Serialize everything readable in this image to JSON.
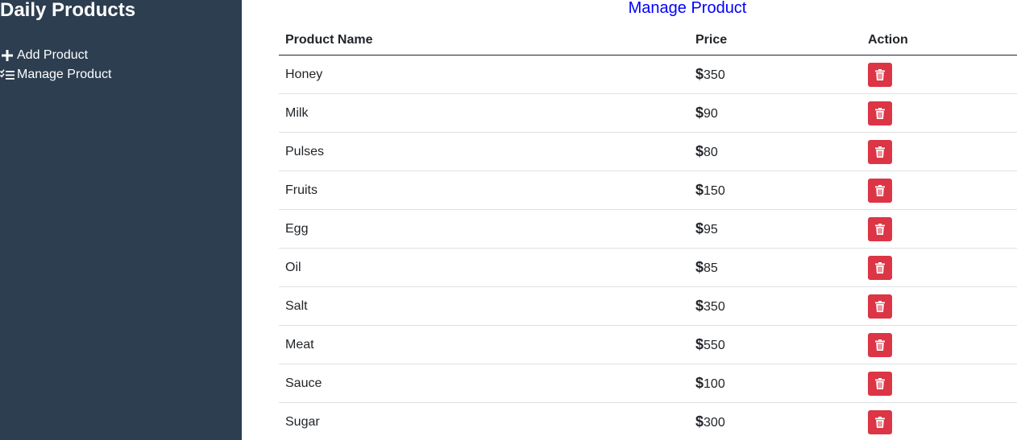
{
  "sidebar": {
    "brand": "Daily Products",
    "nav": [
      {
        "label": "Add Product",
        "icon": "plus-icon"
      },
      {
        "label": "Manage Product",
        "icon": "checklist-icon"
      }
    ]
  },
  "main": {
    "title": "Manage Product",
    "table": {
      "headers": [
        "Product Name",
        "Price",
        "Action"
      ],
      "currency_symbol": "$",
      "rows": [
        {
          "name": "Honey",
          "price": "350"
        },
        {
          "name": "Milk",
          "price": "90"
        },
        {
          "name": "Pulses",
          "price": "80"
        },
        {
          "name": "Fruits",
          "price": "150"
        },
        {
          "name": "Egg",
          "price": "95"
        },
        {
          "name": "Oil",
          "price": "85"
        },
        {
          "name": "Salt",
          "price": "350"
        },
        {
          "name": "Meat",
          "price": "550"
        },
        {
          "name": "Sauce",
          "price": "100"
        },
        {
          "name": "Sugar",
          "price": "300"
        }
      ]
    }
  },
  "colors": {
    "sidebar_bg": "#2c3e50",
    "title": "#0000ff",
    "delete_button": "#dc3545"
  },
  "icons": {
    "delete": "trash-icon"
  }
}
